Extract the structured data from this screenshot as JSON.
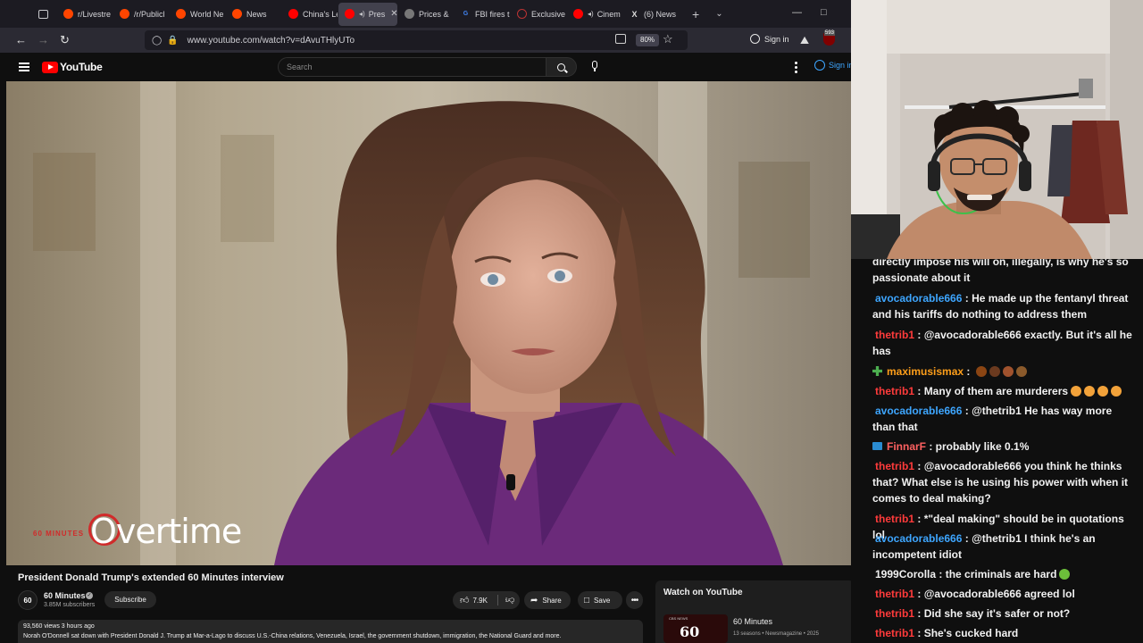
{
  "browser": {
    "tabs": [
      {
        "label": "r/Livestre",
        "favicon": "reddit",
        "active": false
      },
      {
        "label": "/r/Publicl",
        "favicon": "reddit",
        "active": false
      },
      {
        "label": "World Ne",
        "favicon": "reddit",
        "active": false
      },
      {
        "label": "News",
        "favicon": "reddit",
        "active": false
      },
      {
        "label": "China's Le",
        "favicon": "youtube",
        "active": false
      },
      {
        "label": "Pres",
        "favicon": "youtube",
        "active": true
      },
      {
        "label": "Prices &",
        "favicon": "page",
        "active": false
      },
      {
        "label": "FBI fires t",
        "favicon": "g",
        "active": false
      },
      {
        "label": "Exclusive",
        "favicon": "circle",
        "active": false
      },
      {
        "label": "Cinem",
        "favicon": "youtube",
        "active": false
      },
      {
        "label": "(6) News",
        "favicon": "x",
        "active": false
      }
    ],
    "url": "www.youtube.com/watch?v=dAvuTHlyUTo",
    "zoom": "80%",
    "sign_in": "Sign in",
    "ublock_count": "593"
  },
  "youtube": {
    "logo_text": "YouTube",
    "search_placeholder": "Search",
    "sign_in": "Sign in",
    "video_overlay_logo": "60 MINUTES",
    "video_overlay_text": "Overtime",
    "video_title": "President Donald Trump's extended 60 Minutes interview",
    "channel": {
      "name": "60 Minutes",
      "subscribers": "3.85M subscribers",
      "avatar_text": "60"
    },
    "subscribe_label": "Subscribe",
    "likes": "7.9K",
    "share_label": "Share",
    "save_label": "Save",
    "views_line": "93,560 views  3 hours ago",
    "description": "Norah O'Donnell sat down with President Donald J. Trump at Mar-a-Lago to discuss U.S.-China relations, Venezuela, Israel, the government shutdown, immigration, the National Guard and more.",
    "watch_on_youtube": {
      "title": "Watch on YouTube",
      "name": "60 Minutes",
      "meta": "13 seasons • Newsmagazine • 2025",
      "thumb_text": "60",
      "thumb_network": "CBS NEWS"
    }
  },
  "chat": {
    "messages": [
      {
        "user": "",
        "text": "directly impose his will on, illegally, is why he's so passionate about it",
        "color": "#f1f1f1"
      },
      {
        "user": "avocadorable666",
        "text": "He made up the fentanyl threat and his tariffs do nothing to address them",
        "color": "#3ea6ff"
      },
      {
        "user": "thetrib1",
        "text": "@avocadorable666 exactly. But it's all he has",
        "color": "#ff3b3b"
      },
      {
        "user": "maximusismax",
        "text": "",
        "color": "#ff9f1a",
        "badge": "plus"
      },
      {
        "user": "thetrib1",
        "text": "Many of them are murderers",
        "color": "#ff3b3b"
      },
      {
        "user": "avocadorable666",
        "text": "@thetrib1 He has way more than that",
        "color": "#3ea6ff"
      },
      {
        "user": "FinnarF",
        "text": "probably like 0.1%",
        "color": "#ff6161",
        "badge": "box"
      },
      {
        "user": "thetrib1",
        "text": "@avocadorable666 you think he thinks that? What else is he using his power with when it comes to deal making?",
        "color": "#ff3b3b"
      },
      {
        "user": "thetrib1",
        "text": "*\"deal making\" should be in quotations lol",
        "color": "#ff3b3b"
      },
      {
        "user": "avocadorable666",
        "text": "@thetrib1 I think he's an incompetent idiot",
        "color": "#3ea6ff"
      },
      {
        "user": "1999Corolla",
        "text": "the criminals are hard",
        "color": "#f1f1f1"
      },
      {
        "user": "thetrib1",
        "text": "@avocadorable666 agreed lol",
        "color": "#ff3b3b"
      },
      {
        "user": "thetrib1",
        "text": "Did she say it's safer or not?",
        "color": "#ff3b3b"
      },
      {
        "user": "thetrib1",
        "text": "She's cucked hard",
        "color": "#ff3b3b"
      }
    ]
  }
}
